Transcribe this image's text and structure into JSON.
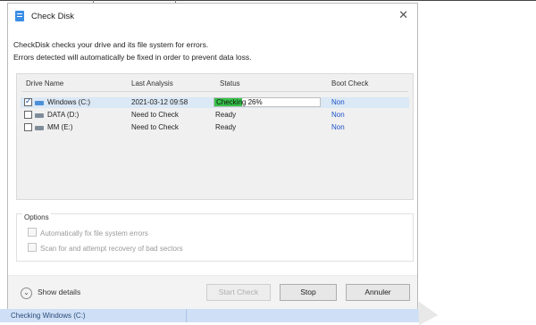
{
  "dialog": {
    "title": "Check Disk",
    "intro_line1": "CheckDisk checks your drive and its file system for errors.",
    "intro_line2": "Errors detected will automatically be fixed in order to prevent data loss."
  },
  "table": {
    "headers": [
      "Drive Name",
      "Last Analysis",
      "Status",
      "Boot Check"
    ],
    "rows": [
      {
        "name": "Windows (C:)",
        "last": "2021-03-12 09:58",
        "status": "Checking 26%",
        "progress": 0.26,
        "boot": "Non",
        "checked": true
      },
      {
        "name": "DATA (D:)",
        "last": "Need to Check",
        "status": "Ready",
        "boot": "Non",
        "checked": false
      },
      {
        "name": "MM (E:)",
        "last": "Need to Check",
        "status": "Ready",
        "boot": "Non",
        "checked": false
      }
    ]
  },
  "options": {
    "title": "Options",
    "opt1": "Automatically fix file system errors",
    "opt2": "Scan for and attempt recovery of bad sectors"
  },
  "footer": {
    "show_details": "Show details",
    "start_check": "Start Check",
    "stop": "Stop",
    "cancel": "Annuler"
  },
  "taskbar": {
    "status": "Checking Windows (C:)"
  },
  "colors": {
    "accent": "#3a8ee6",
    "progress": "#35c24a",
    "link": "#1c52c7"
  }
}
